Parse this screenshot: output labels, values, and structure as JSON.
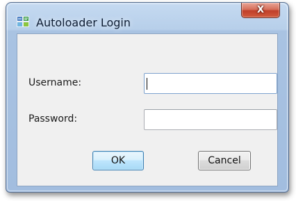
{
  "window": {
    "title": "Autoloader Login",
    "icon": "autoloader-app-icon",
    "close_icon_glyph": "X"
  },
  "form": {
    "username_label": "Username:",
    "username_value": "",
    "password_label": "Password:",
    "password_value": ""
  },
  "buttons": {
    "ok_label": "OK",
    "cancel_label": "Cancel"
  },
  "colors": {
    "frame": "#a9c3e2",
    "client_bg": "#f0f0f0",
    "close_button": "#c0402a",
    "default_button_border": "#3c7fb1"
  }
}
